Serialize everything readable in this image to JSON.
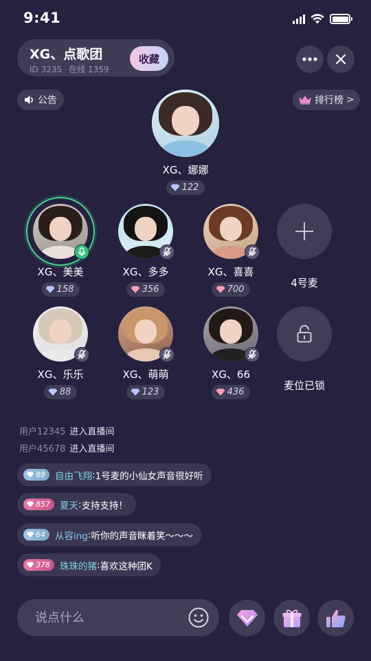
{
  "status_bar": {
    "time": "9:41"
  },
  "room": {
    "name": "XG、点歌团",
    "id_label": "ID 3235",
    "online_label": "在线 1359",
    "favorite_label": "收藏"
  },
  "chips": {
    "notice_label": "公告",
    "rank_label": "排行榜",
    "rank_arrow": ">"
  },
  "host": {
    "name": "XG、娜娜",
    "gems": "122",
    "gem_color": "#b9c6ff"
  },
  "seats": [
    {
      "name": "XG、美美",
      "gems": "158",
      "gem_color": "#b9c6ff",
      "mic": "on",
      "speaking": true
    },
    {
      "name": "XG、多多",
      "gems": "356",
      "gem_color": "#ff9db8",
      "mic": "off"
    },
    {
      "name": "XG、喜喜",
      "gems": "700",
      "gem_color": "#ff9db8",
      "mic": "off"
    },
    {
      "name": "4号麦",
      "empty": true,
      "icon": "plus-icon"
    },
    {
      "name": "XG、乐乐",
      "gems": "88",
      "gem_color": "#b9c6ff",
      "mic": "off"
    },
    {
      "name": "XG、萌萌",
      "gems": "123",
      "gem_color": "#b9c6ff",
      "mic": "off"
    },
    {
      "name": "XG、66",
      "gems": "436",
      "gem_color": "#ff9db8",
      "mic": "off"
    },
    {
      "name": "麦位已锁",
      "locked": true,
      "icon": "lock-icon"
    }
  ],
  "system_messages": [
    {
      "user": "用户12345",
      "action": "进入直播间"
    },
    {
      "user": "用户45678",
      "action": "进入直播间"
    }
  ],
  "chat": [
    {
      "level": "88",
      "level_color": "blue",
      "user": "自由飞翔",
      "colon": ":",
      "text": "1号麦的小仙女声音很好听"
    },
    {
      "level": "857",
      "level_color": "pink",
      "user": "夏天",
      "colon": ":",
      "text": "支持支持！"
    },
    {
      "level": "64",
      "level_color": "blue",
      "user": "从容ing",
      "colon": ":",
      "text": "听你的声音眯着笑～～～"
    },
    {
      "level": "378",
      "level_color": "pink",
      "user": "珠珠的猪",
      "colon": ":",
      "text": "喜欢这种团K"
    }
  ],
  "bottom_bar": {
    "input_placeholder": "说点什么",
    "actions": [
      "gem-icon",
      "gift-icon",
      "like-icon"
    ]
  }
}
